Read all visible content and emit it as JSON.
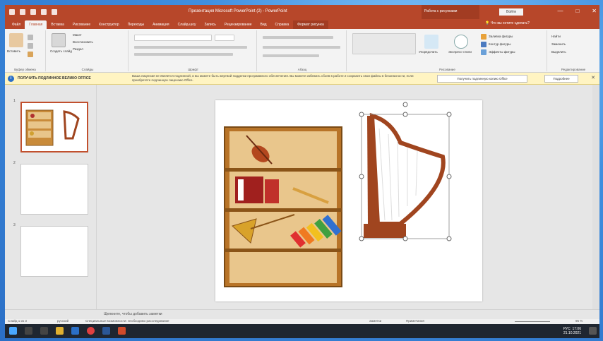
{
  "window": {
    "title": "Презентация Microsoft PowerPoint (2) - PowerPoint",
    "context_title": "Работа с рисунками",
    "signin": "Войти",
    "controls": [
      "—",
      "□",
      "✕"
    ]
  },
  "qat_icons": [
    "save-icon",
    "undo-icon",
    "redo-icon",
    "slideshow-icon",
    "customize-icon"
  ],
  "tabs": [
    {
      "label": "Файл",
      "active": false
    },
    {
      "label": "Главная",
      "active": true
    },
    {
      "label": "Вставка",
      "active": false
    },
    {
      "label": "Рисование",
      "active": false
    },
    {
      "label": "Конструктор",
      "active": false
    },
    {
      "label": "Переходы",
      "active": false
    },
    {
      "label": "Анимация",
      "active": false
    },
    {
      "label": "Слайд-шоу",
      "active": false
    },
    {
      "label": "Запись",
      "active": false
    },
    {
      "label": "Рецензирование",
      "active": false
    },
    {
      "label": "Вид",
      "active": false
    },
    {
      "label": "Справка",
      "active": false
    },
    {
      "label": "Формат рисунка",
      "active": false,
      "contextual": true
    }
  ],
  "tell_me": "Что вы хотите сделать?",
  "ribbon": {
    "groups": {
      "clipboard": "Буфер обмена",
      "slides": "Слайды",
      "font": "Шрифт",
      "paragraph": "Абзац",
      "drawing": "Рисование",
      "editing": "Редактирование"
    },
    "paste": "Вставить",
    "new_slide": "Создать слайд",
    "layout": "Макет",
    "reset": "Восстановить",
    "section": "Раздел",
    "arrange": "Упорядочить",
    "quick_styles": "Экспресс-стили",
    "shape_fill": "Заливка фигуры",
    "shape_outline": "Контур фигуры",
    "shape_effects": "Эффекты фигуры",
    "find": "Найти",
    "replace": "Заменить",
    "select": "Выделить"
  },
  "notice": {
    "title": "ПОЛУЧИТЬ ПОДЛИННОЕ ВЕЛИКО OFFICE",
    "text": "Ваша лицензия не является подлинной, и вы можете быть жертвой подделки программного обеспечения. Вы можете избежать сбоев в работе и сохранить свои файлы в безопасности, если приобретете подлинную лицензию Office.",
    "button_primary": "Получить подлинную копию Office",
    "button_secondary": "Подробнее"
  },
  "slides": [
    {
      "number": "1",
      "selected": true
    },
    {
      "number": "2",
      "selected": false
    },
    {
      "number": "3",
      "selected": false
    }
  ],
  "notes_placeholder": "Щелкните, чтобы добавить заметки",
  "status": {
    "slide": "Слайд 1 из 3",
    "language": "русский",
    "accessibility": "Специальные возможности: необходимо расследование",
    "notes": "Заметки",
    "comments": "Примечания",
    "zoom": "95 %"
  },
  "taskbar": {
    "time": "17:06",
    "date": "21.10.2021",
    "lang": "РУС"
  },
  "colors": {
    "accent": "#b7472a",
    "accent_dark": "#a23c22",
    "notice_bg": "#fff4c2",
    "shelf_wood": "#c98b3a"
  }
}
